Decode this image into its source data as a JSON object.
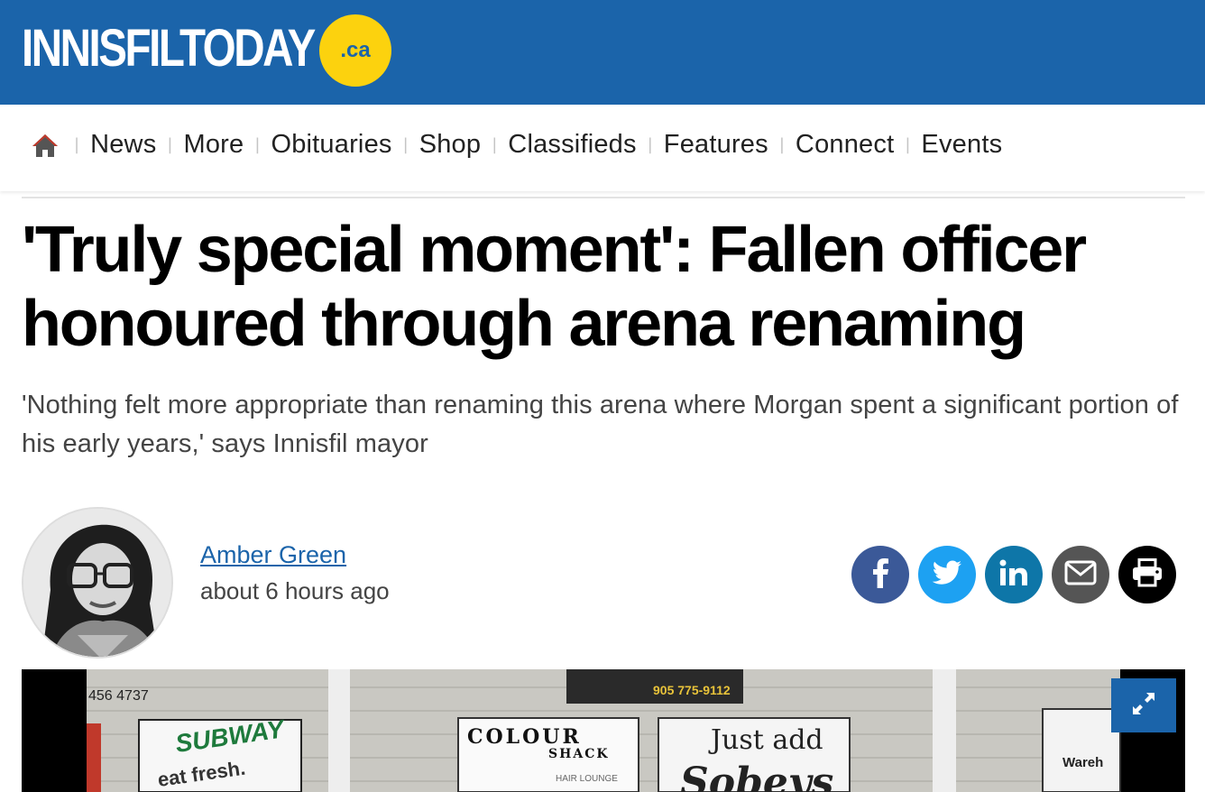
{
  "site": {
    "logo_main": "INNISFILTODAY",
    "logo_suffix": ".ca"
  },
  "nav": {
    "home_icon": "home-icon",
    "items": [
      "News",
      "More",
      "Obituaries",
      "Shop",
      "Classifieds",
      "Features",
      "Connect",
      "Events"
    ]
  },
  "article": {
    "title": "'Truly special moment': Fallen officer honoured through arena renaming",
    "subtitle": "'Nothing felt more appropriate than renaming this arena where Morgan spent a significant portion of his early years,' says Innisfil mayor",
    "author": "Amber Green",
    "time": "about 6 hours ago"
  },
  "share": {
    "icons": [
      "facebook-icon",
      "twitter-icon",
      "linkedin-icon",
      "email-icon",
      "print-icon"
    ]
  },
  "photo": {
    "sign_phone_1": "456 4737",
    "sign_subway": "SUBWAY",
    "sign_subway_tag": "eat fresh.",
    "sign_colour": "COLOUR",
    "sign_shack": "SHACK",
    "sign_hair": "HAIR LOUNGE",
    "sign_just_add": "Just add",
    "sign_sobeys": "Sobeys",
    "sign_phone_2": "905 775-9112",
    "sign_ware": "Wareh",
    "expand_icon": "expand-icon"
  },
  "colors": {
    "brand_blue": "#1b64aa",
    "logo_yellow": "#fcd20e",
    "facebook": "#3b5998",
    "twitter": "#1da1f2",
    "linkedin": "#0e76a8",
    "email": "#555555",
    "print": "#000000"
  }
}
